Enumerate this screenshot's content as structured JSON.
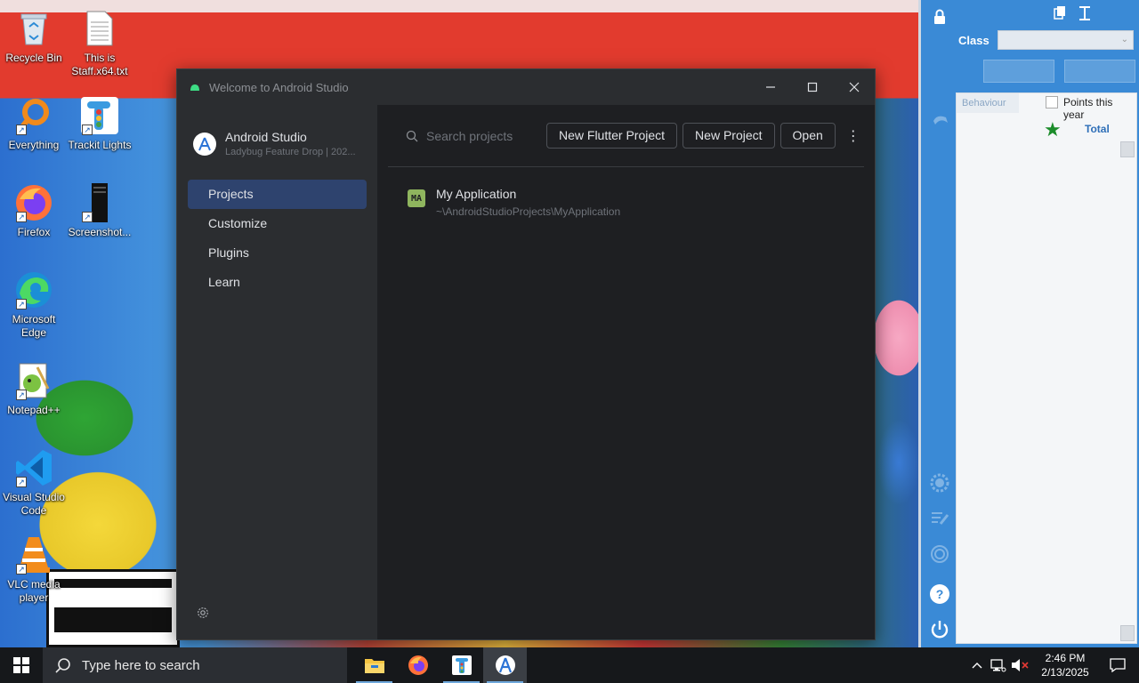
{
  "desktop": {
    "icons": [
      {
        "label": "Recycle Bin",
        "icon": "recycle-bin-icon"
      },
      {
        "label": "This is Staff.x64.txt",
        "icon": "text-file-icon"
      },
      {
        "label": "Everything",
        "icon": "everything-search-icon"
      },
      {
        "label": "Trackit Lights",
        "icon": "traffic-light-icon"
      },
      {
        "label": "Firefox",
        "icon": "firefox-icon"
      },
      {
        "label": "Screenshot...",
        "icon": "screenshot-icon"
      },
      {
        "label": "Microsoft Edge",
        "icon": "edge-icon"
      },
      {
        "label": "Notepad++",
        "icon": "notepad-plus-plus-icon"
      },
      {
        "label": "Visual Studio Code",
        "icon": "vscode-icon"
      },
      {
        "label": "VLC media player",
        "icon": "vlc-icon"
      }
    ]
  },
  "android_studio": {
    "window_title": "Welcome to Android Studio",
    "brand_name": "Android Studio",
    "brand_version": "Ladybug Feature Drop | 202...",
    "nav": [
      "Projects",
      "Customize",
      "Plugins",
      "Learn"
    ],
    "active_nav": "Projects",
    "search_placeholder": "Search projects",
    "buttons": {
      "new_flutter": "New Flutter Project",
      "new_project": "New Project",
      "open": "Open"
    },
    "projects": [
      {
        "badge": "MA",
        "name": "My Application",
        "path": "~\\AndroidStudioProjects\\MyApplication"
      }
    ],
    "colors": {
      "accent": "#2e436e",
      "badge": "#8fb55e"
    }
  },
  "class_panel": {
    "class_label": "Class",
    "tab_label": "Behaviour",
    "checkbox_label": "Points this year",
    "total_label": "Total"
  },
  "taskbar": {
    "search_placeholder": "Type here to search",
    "time": "2:46 PM",
    "date": "2/13/2025"
  }
}
